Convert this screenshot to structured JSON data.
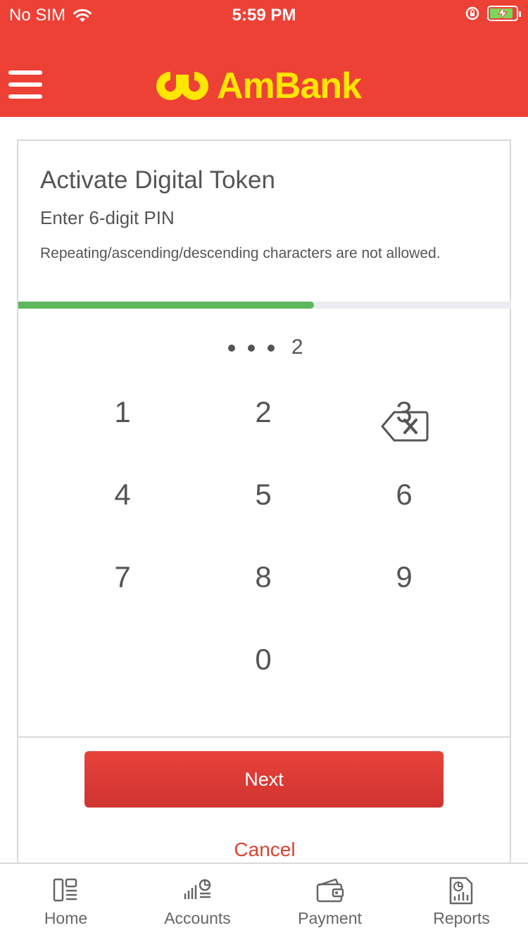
{
  "status_bar": {
    "carrier": "No SIM",
    "time": "5:59 PM"
  },
  "header": {
    "brand": "AmBank",
    "brand_color": "#ffe600",
    "bar_color": "#ee4136"
  },
  "card": {
    "title": "Activate Digital Token",
    "subtitle": "Enter 6-digit PIN",
    "hint": "Repeating/ascending/descending characters are not allowed.",
    "progress_fraction": 0.6,
    "pin_masked_count": 3,
    "pin_last_digit": "2",
    "keypad": [
      "1",
      "2",
      "3",
      "4",
      "5",
      "6",
      "7",
      "8",
      "9",
      "0"
    ],
    "next_label": "Next",
    "cancel_label": "Cancel"
  },
  "tabbar": {
    "items": [
      {
        "label": "Home",
        "icon": "home-icon"
      },
      {
        "label": "Accounts",
        "icon": "accounts-icon"
      },
      {
        "label": "Payment",
        "icon": "wallet-icon"
      },
      {
        "label": "Reports",
        "icon": "reports-icon"
      }
    ]
  }
}
